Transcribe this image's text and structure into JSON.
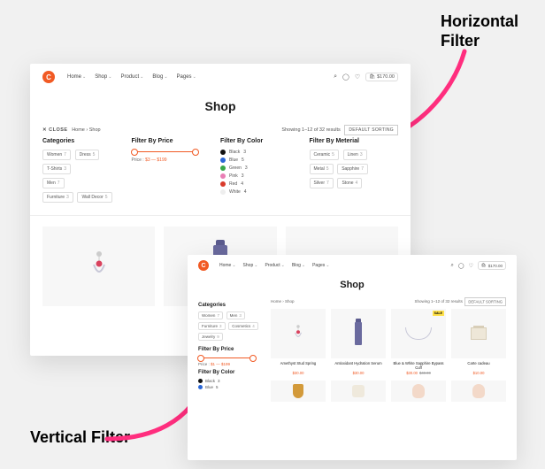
{
  "annotations": {
    "horizontal": "Horizontal\nFilter",
    "vertical": "Vertical Filter"
  },
  "nav": {
    "home": "Home",
    "shop": "Shop",
    "product": "Product",
    "blog": "Blog",
    "pages": "Pages"
  },
  "top": {
    "logo": "C",
    "cart_total": "$170.00"
  },
  "page_title": "Shop",
  "toolbar": {
    "close": "✕  CLOSE",
    "breadcrumb": "Home  ›  Shop",
    "result_count": "Showing 1–12 of 32 results",
    "sort_label": "DEFAULT SORTING"
  },
  "filters": {
    "categories_label": "Categories",
    "price_label": "Filter By Price",
    "color_label": "Filter By Color",
    "material_label": "Filter By Meterial",
    "price_prefix": "Price :",
    "price_value": "$3 — $199",
    "price_value_short": "$1 — $199",
    "categories_h": [
      {
        "name": "Women",
        "count": "7"
      },
      {
        "name": "Dress",
        "count": "5"
      },
      {
        "name": "T-Shirts",
        "count": "3"
      },
      {
        "name": "Men",
        "count": "7"
      },
      {
        "name": "Furniture",
        "count": "3"
      },
      {
        "name": "Wall Decor",
        "count": "5"
      }
    ],
    "categories_v": [
      {
        "name": "Women",
        "count": "7"
      },
      {
        "name": "Men",
        "count": "3"
      },
      {
        "name": "Furniture",
        "count": "3"
      },
      {
        "name": "Cosmetics",
        "count": "4"
      },
      {
        "name": "Jewelry",
        "count": "9"
      }
    ],
    "colors": [
      {
        "name": "Black",
        "count": "3",
        "hex": "#111"
      },
      {
        "name": "Blue",
        "count": "5",
        "hex": "#2b67d6"
      },
      {
        "name": "Green",
        "count": "3",
        "hex": "#38a849"
      },
      {
        "name": "Pink",
        "count": "3",
        "hex": "#e97fb5"
      },
      {
        "name": "Red",
        "count": "4",
        "hex": "#d93a2b"
      },
      {
        "name": "White",
        "count": "4",
        "hex": "#eee"
      }
    ],
    "colors_short": [
      {
        "name": "Black",
        "count": "3",
        "hex": "#111"
      },
      {
        "name": "Blue",
        "count": "5",
        "hex": "#2b67d6"
      }
    ],
    "materials": [
      {
        "name": "Ceramic",
        "count": "5"
      },
      {
        "name": "Linen",
        "count": "3"
      },
      {
        "name": "Metal",
        "count": "5"
      },
      {
        "name": "Sapphire",
        "count": "7"
      },
      {
        "name": "Silver",
        "count": "7"
      },
      {
        "name": "Stone",
        "count": "4"
      }
    ]
  },
  "products": [
    {
      "name": "Amethyst Stud Spring",
      "price": "$30.00",
      "old": ""
    },
    {
      "name": "Antioxidant Hydration Serum",
      "price": "$30.00",
      "old": ""
    },
    {
      "name": "Blue & White Sapphire Bypass Cuff",
      "price": "$30.00",
      "old": "$40.00",
      "sale": "SALE"
    },
    {
      "name": "Carte cadeau",
      "price": "$10.00",
      "old": ""
    }
  ]
}
